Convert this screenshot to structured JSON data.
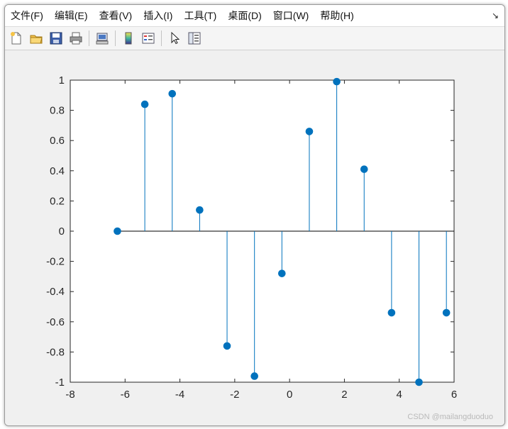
{
  "menubar": {
    "items": [
      {
        "label": "文件(F)"
      },
      {
        "label": "编辑(E)"
      },
      {
        "label": "查看(V)"
      },
      {
        "label": "插入(I)"
      },
      {
        "label": "工具(T)"
      },
      {
        "label": "桌面(D)"
      },
      {
        "label": "窗口(W)"
      },
      {
        "label": "帮助(H)"
      }
    ],
    "dock_glyph": "↘"
  },
  "toolbar": {
    "buttons": [
      "new-figure-icon",
      "open-file-icon",
      "save-icon",
      "print-icon",
      "link-plot-icon",
      "insert-colorbar-icon",
      "insert-legend-icon",
      "edit-plot-arrow-icon",
      "property-inspector-icon"
    ]
  },
  "chart_data": {
    "type": "stem",
    "x": [
      -6.28,
      -5.28,
      -4.28,
      -3.28,
      -2.28,
      -1.28,
      -0.28,
      0.72,
      1.72,
      2.72,
      3.72,
      4.72,
      5.72
    ],
    "y": [
      0.0,
      0.84,
      0.91,
      0.14,
      -0.76,
      -0.96,
      -0.28,
      0.66,
      0.99,
      0.41,
      -0.54,
      -1.0,
      -0.54
    ],
    "xlim": [
      -8,
      6
    ],
    "ylim": [
      -1,
      1
    ],
    "xticks": [
      "-8",
      "-6",
      "-4",
      "-2",
      "0",
      "2",
      "4",
      "6"
    ],
    "yticks": [
      "1",
      "0.8",
      "0.6",
      "0.4",
      "0.2",
      "0",
      "-0.2",
      "-0.4",
      "-0.6",
      "-0.8",
      "-1"
    ],
    "baseline": 0,
    "color": "#0072bd",
    "title": "",
    "xlabel": "",
    "ylabel": ""
  },
  "watermark": "CSDN @mailangduoduo"
}
